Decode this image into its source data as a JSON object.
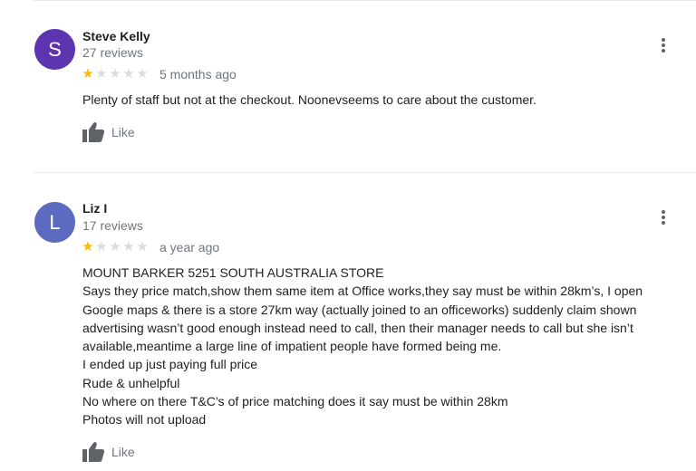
{
  "colors": {
    "avatar_steve": "#5e35b1",
    "avatar_liz": "#5c6bc0",
    "star_filled": "#fbbc04",
    "star_empty": "#dadce0",
    "secondary_text": "#70757a"
  },
  "like_label": "Like",
  "reviews": [
    {
      "initial": "S",
      "name": "Steve Kelly",
      "review_count": "27 reviews",
      "rating": 1,
      "max_rating": 5,
      "date": "5 months ago",
      "text_lines": [
        "Plenty of staff but not at the checkout. Noonevseems to care about the customer."
      ]
    },
    {
      "initial": "L",
      "name": "Liz I",
      "review_count": "17 reviews",
      "rating": 1,
      "max_rating": 5,
      "date": "a year ago",
      "text_lines": [
        "MOUNT BARKER 5251 SOUTH AUSTRALIA STORE",
        "Says they price match,show them same item at Office works,they say must be within 28km’s, I open",
        "Google maps & there is a store 27km way (actually joined to an officeworks) suddenly claim shown",
        "advertising wasn’t good enough instead need to call, then their manager needs to call but she isn’t",
        "available,meantime a large line of impatient people have formed being me.",
        "I ended up just paying full price",
        "Rude & unhelpful",
        "No where on there T&C’s of price matching does it say must be within 28km",
        "Photos will not upload"
      ]
    }
  ]
}
